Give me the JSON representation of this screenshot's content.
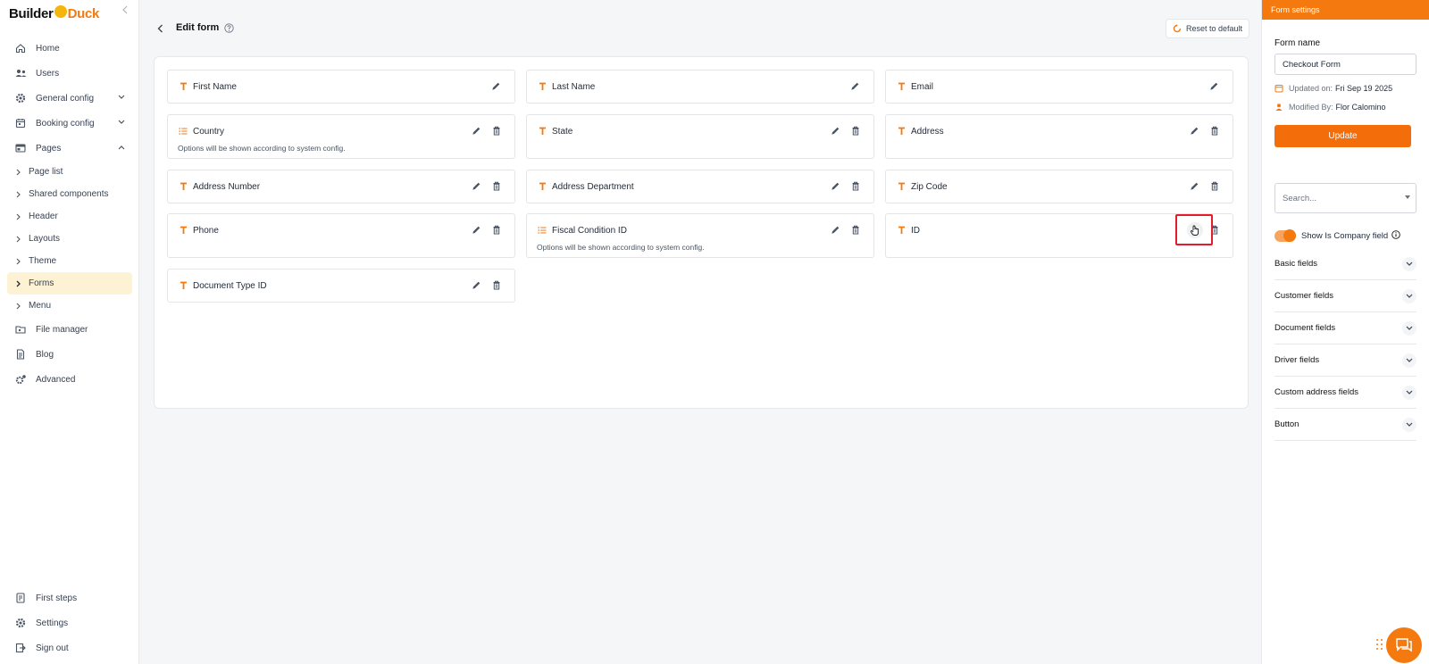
{
  "brand": {
    "part1": "Builder",
    "part2": "Duck"
  },
  "sidebar": {
    "items": [
      {
        "label": "Home",
        "icon": "home-icon"
      },
      {
        "label": "Users",
        "icon": "users-icon"
      },
      {
        "label": "General config",
        "icon": "gear-icon",
        "expandable": true
      },
      {
        "label": "Booking config",
        "icon": "calendar-icon",
        "expandable": true
      },
      {
        "label": "Pages",
        "icon": "pages-icon",
        "expanded": true
      }
    ],
    "subitems": [
      {
        "label": "Page list"
      },
      {
        "label": "Shared components"
      },
      {
        "label": "Header"
      },
      {
        "label": "Layouts"
      },
      {
        "label": "Theme"
      },
      {
        "label": "Forms",
        "active": true
      },
      {
        "label": "Menu"
      }
    ],
    "items_after": [
      {
        "label": "File manager",
        "icon": "folder-icon"
      },
      {
        "label": "Blog",
        "icon": "blog-icon"
      },
      {
        "label": "Advanced",
        "icon": "advanced-icon"
      }
    ],
    "bottom": [
      {
        "label": "First steps",
        "icon": "book-icon"
      },
      {
        "label": "Settings",
        "icon": "gear-icon"
      },
      {
        "label": "Sign out",
        "icon": "sign-out-icon"
      }
    ]
  },
  "header": {
    "title": "Edit form",
    "reset_label": "Reset to default"
  },
  "fields": [
    {
      "label": "First Name",
      "type": "text",
      "deletable": false
    },
    {
      "label": "Last Name",
      "type": "text",
      "deletable": false
    },
    {
      "label": "Email",
      "type": "text",
      "deletable": false
    },
    {
      "label": "Country",
      "type": "list",
      "deletable": true,
      "subtitle": "Options will be shown according to system config."
    },
    {
      "label": "State",
      "type": "text",
      "deletable": true
    },
    {
      "label": "Address",
      "type": "text",
      "deletable": true
    },
    {
      "label": "Address Number",
      "type": "text",
      "deletable": true
    },
    {
      "label": "Address Department",
      "type": "text",
      "deletable": true
    },
    {
      "label": "Zip Code",
      "type": "text",
      "deletable": true
    },
    {
      "label": "Phone",
      "type": "text",
      "deletable": true
    },
    {
      "label": "Fiscal Condition ID",
      "type": "list",
      "deletable": true,
      "subtitle": "Options will be shown according to system config."
    },
    {
      "label": "ID",
      "type": "text",
      "deletable": true
    },
    {
      "label": "Document Type ID",
      "type": "text",
      "deletable": true
    }
  ],
  "settings": {
    "header": "Form settings",
    "form_name_label": "Form name",
    "form_name_value": "Checkout Form",
    "updated_label": "Updated on:",
    "updated_value": "Fri Sep 19 2025",
    "modified_label": "Modified By:",
    "modified_value": "Flor Calomino",
    "update_label": "Update",
    "search_placeholder": "Search...",
    "toggle_label": "Show Is Company field",
    "toggle_on": true,
    "sections": [
      "Basic fields",
      "Customer fields",
      "Document fields",
      "Driver fields",
      "Custom address fields",
      "Button"
    ]
  },
  "colors": {
    "accent": "#f47a10",
    "active_nav": "#fdf3d4",
    "highlight": "#e11d2b"
  }
}
